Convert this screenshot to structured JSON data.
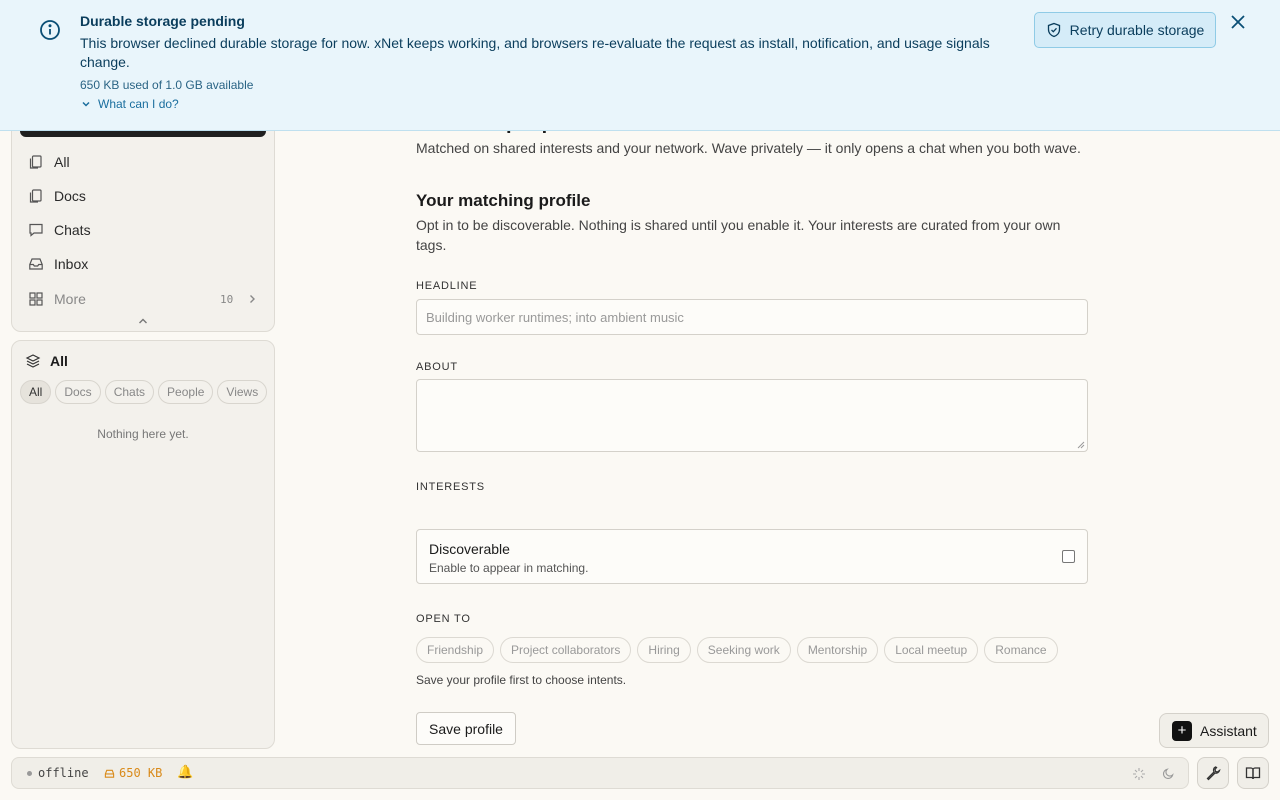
{
  "banner": {
    "title": "Durable storage pending",
    "description": "This browser declined durable storage for now. xNet keeps working, and browsers re-evaluate the request as install, notification, and usage signals change.",
    "usage": "650 KB used of 1.0 GB available",
    "help_link": "What can I do?",
    "retry_label": "Retry durable storage"
  },
  "sidebar": {
    "nav": [
      {
        "label": "All",
        "icon": "file-stack-icon"
      },
      {
        "label": "Docs",
        "icon": "docs-icon"
      },
      {
        "label": "Chats",
        "icon": "chat-icon"
      },
      {
        "label": "Inbox",
        "icon": "inbox-icon"
      }
    ],
    "more": {
      "label": "More",
      "count": "10"
    },
    "all_panel": {
      "title": "All",
      "filters": [
        "All",
        "Docs",
        "Chats",
        "People",
        "Views"
      ],
      "active_filter": "All",
      "empty_text": "Nothing here yet."
    }
  },
  "main": {
    "peek_title": "Discover people",
    "subtitle": "Matched on shared interests and your network. Wave privately — it only opens a chat when you both wave.",
    "profile_title": "Your matching profile",
    "profile_desc": "Opt in to be discoverable. Nothing is shared until you enable it. Your interests are curated from your own tags.",
    "headline_label": "HEADLINE",
    "headline_placeholder": "Building worker runtimes; into ambient music",
    "about_label": "ABOUT",
    "interests_label": "INTERESTS",
    "discoverable_title": "Discoverable",
    "discoverable_desc": "Enable to appear in matching.",
    "discoverable_checked": false,
    "open_to_label": "OPEN TO",
    "intents": [
      "Friendship",
      "Project collaborators",
      "Hiring",
      "Seeking work",
      "Mentorship",
      "Local meetup",
      "Romance"
    ],
    "intents_hint": "Save your profile first to choose intents.",
    "save_label": "Save profile"
  },
  "assistant_label": "Assistant",
  "status": {
    "connection": "offline",
    "storage": "650 KB"
  }
}
